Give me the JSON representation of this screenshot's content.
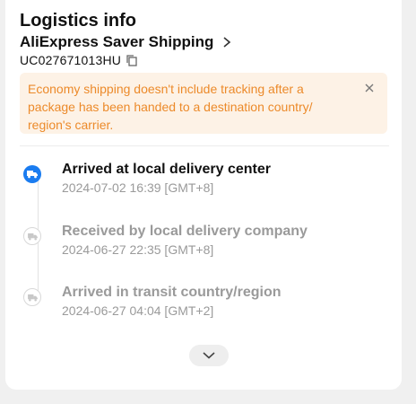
{
  "header": {
    "title": "Logistics info",
    "shipping_method": "AliExpress Saver Shipping",
    "tracking_number": "UC027671013HU"
  },
  "notice": {
    "text": "Economy shipping doesn't include tracking after a package has been handed to a destination country/ region's carrier.",
    "close_icon": "close-icon"
  },
  "timeline": {
    "events": [
      {
        "title": "Arrived at local delivery center",
        "time": "2024-07-02 16:39 [GMT+8]",
        "status": "current",
        "icon": "truck-icon"
      },
      {
        "title": "Received by local delivery company",
        "time": "2024-06-27 22:35 [GMT+8]",
        "status": "past",
        "icon": "truck-icon"
      },
      {
        "title": "Arrived in transit country/region",
        "time": "2024-06-27 04:04 [GMT+2]",
        "status": "past",
        "icon": "truck-icon"
      }
    ]
  },
  "colors": {
    "accent": "#1a7cf0",
    "notice_bg": "#fdf2e6",
    "notice_text": "#ec8a2a",
    "muted_text": "#9a9a9a"
  }
}
